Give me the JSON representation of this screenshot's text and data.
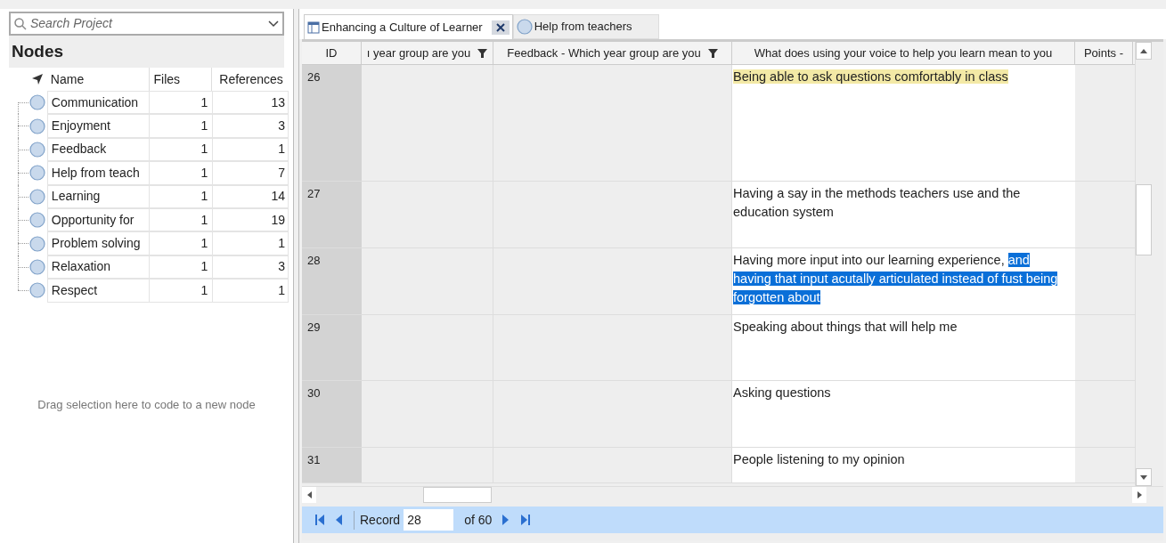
{
  "search": {
    "placeholder": "Search Project"
  },
  "nodes": {
    "title": "Nodes",
    "columns": [
      "Name",
      "Files",
      "References"
    ],
    "rows": [
      {
        "name": "Communication",
        "files": "1",
        "references": "13"
      },
      {
        "name": "Enjoyment",
        "files": "1",
        "references": "3"
      },
      {
        "name": "Feedback",
        "files": "1",
        "references": "1"
      },
      {
        "name": "Help from teach",
        "files": "1",
        "references": "7"
      },
      {
        "name": "Learning",
        "files": "1",
        "references": "14"
      },
      {
        "name": "Opportunity for",
        "files": "1",
        "references": "19"
      },
      {
        "name": "Problem solving",
        "files": "1",
        "references": "1"
      },
      {
        "name": "Relaxation",
        "files": "1",
        "references": "3"
      },
      {
        "name": "Respect",
        "files": "1",
        "references": "1"
      }
    ],
    "drop_hint": "Drag selection here to code to a new node"
  },
  "tabs": [
    {
      "label": "Enhancing a Culture of Learner",
      "kind": "table",
      "selected": true
    },
    {
      "label": "Help from teachers",
      "kind": "node",
      "selected": false
    }
  ],
  "grid": {
    "columns": [
      {
        "label": "ID",
        "filter": false
      },
      {
        "label": "ı year group are you",
        "filter": true
      },
      {
        "label": "Feedback - Which year group are you",
        "filter": true
      },
      {
        "label": "What does using your voice to help you learn mean to you",
        "filter": false
      },
      {
        "label": "Points -",
        "filter": false
      }
    ],
    "rows": [
      {
        "id": "26",
        "answer": [
          {
            "text": "Being able to ask questions comfortably in class",
            "coded": true,
            "selected": false
          }
        ]
      },
      {
        "id": "27",
        "answer": [
          {
            "text": "Having a say in the methods teachers use and the education system",
            "coded": false,
            "selected": false
          }
        ]
      },
      {
        "id": "28",
        "answer": [
          {
            "text": "Having more input into our learning experience, ",
            "coded": false,
            "selected": false
          },
          {
            "text": "and having that input acutally articulated instead of fust being forgotten about",
            "coded": false,
            "selected": true
          }
        ]
      },
      {
        "id": "29",
        "answer": [
          {
            "text": "Speaking about things that will help me",
            "coded": false,
            "selected": false
          }
        ]
      },
      {
        "id": "30",
        "answer": [
          {
            "text": "Asking questions",
            "coded": false,
            "selected": false
          }
        ]
      },
      {
        "id": "31",
        "answer": [
          {
            "text": "People listening to my opinion",
            "coded": false,
            "selected": false
          }
        ]
      }
    ]
  },
  "navigator": {
    "label": "Record",
    "value": "28",
    "total": "of 60"
  }
}
